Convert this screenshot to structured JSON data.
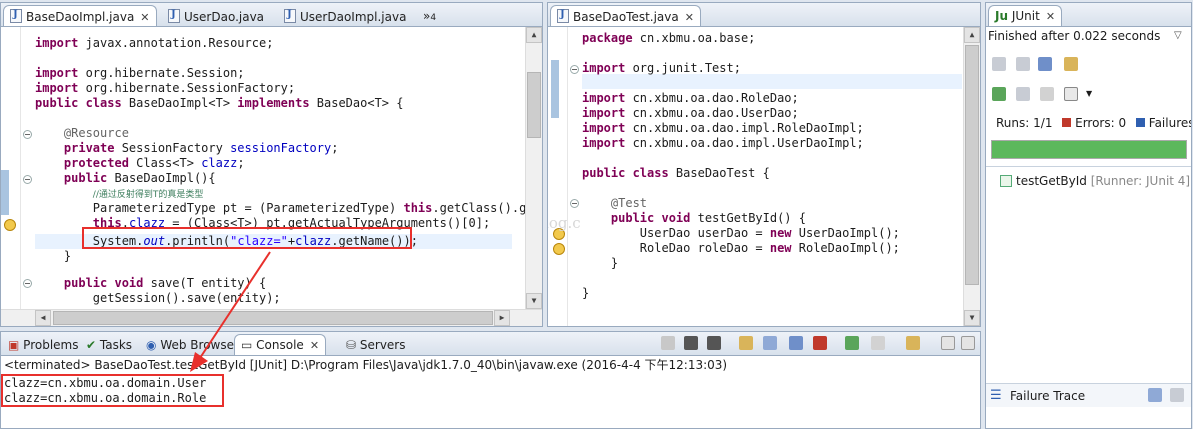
{
  "editor_left": {
    "tabs": [
      {
        "label": "BaseDaoImpl.java",
        "active": true
      },
      {
        "label": "UserDao.java",
        "active": false
      },
      {
        "label": "UserDaoImpl.java",
        "active": false
      }
    ],
    "overflow_count": "4"
  },
  "editor_right": {
    "tab": "BaseDaoTest.java"
  },
  "junit": {
    "tab": "JUnit",
    "finished": "Finished after 0.022 seconds",
    "runs_label": "Runs:",
    "runs_value": "1/1",
    "errors_label": "Errors:",
    "errors_value": "0",
    "failures_label": "Failures:",
    "test_name": "testGetById",
    "test_runner": "[Runner: JUnit 4]",
    "failure_trace": "Failure Trace",
    "progress_fraction": 1.0,
    "progress_color": "#5cb85c"
  },
  "console": {
    "tabs": [
      "Problems",
      "Tasks",
      "Web Browser",
      "Console",
      "Servers"
    ],
    "status": "<terminated> BaseDaoTest.testGetById [JUnit] D:\\Program Files\\Java\\jdk1.7.0_40\\bin\\javaw.exe (2016-4-4 下午12:13:03)",
    "output": [
      "clazz=cn.xbmu.oa.domain.User",
      "clazz=cn.xbmu.oa.domain.Role"
    ]
  },
  "watermark": "http://blog.c",
  "colors": {
    "highlight": "#e8302c",
    "keyword": "#7f0055",
    "field": "#0000c0",
    "string": "#2a00ff"
  }
}
